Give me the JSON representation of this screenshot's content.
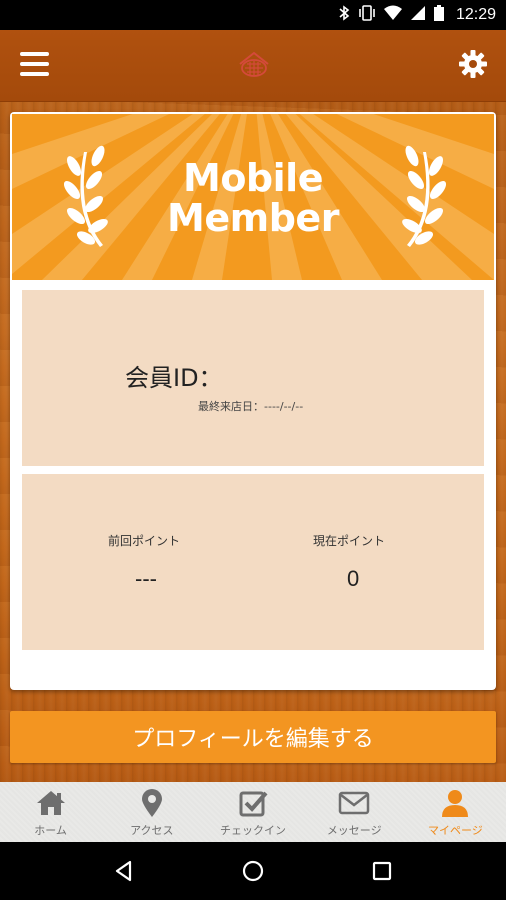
{
  "status_bar": {
    "time": "12:29",
    "icons": [
      "bluetooth-icon",
      "vibrate-icon",
      "wifi-icon",
      "signal-icon",
      "battery-icon"
    ]
  },
  "header": {
    "menu_icon": "hamburger-menu-icon",
    "logo_icon": "restaurant-logo-icon",
    "settings_icon": "gear-icon"
  },
  "banner": {
    "title_line1": "Mobile",
    "title_line2": "Member"
  },
  "member": {
    "id_label": "会員ID：",
    "last_visit": "最終来店日：----/--/--"
  },
  "points": {
    "previous_label": "前回ポイント",
    "previous_value": "---",
    "current_label": "現在ポイント",
    "current_value": "0"
  },
  "edit_profile_label": "プロフィールを編集する",
  "tabs": [
    {
      "label": "ホーム",
      "icon": "home-icon",
      "active": false
    },
    {
      "label": "アクセス",
      "icon": "map-pin-icon",
      "active": false
    },
    {
      "label": "チェックイン",
      "icon": "checkbox-icon",
      "active": false
    },
    {
      "label": "メッセージ",
      "icon": "envelope-icon",
      "active": false
    },
    {
      "label": "マイページ",
      "icon": "person-icon",
      "active": true
    }
  ],
  "colors": {
    "accent": "#f39521",
    "header": "#a44a0b",
    "panel": "#f3dbc3",
    "tab_active": "#ef8a1a",
    "tab_inactive": "#6e6e6e"
  }
}
